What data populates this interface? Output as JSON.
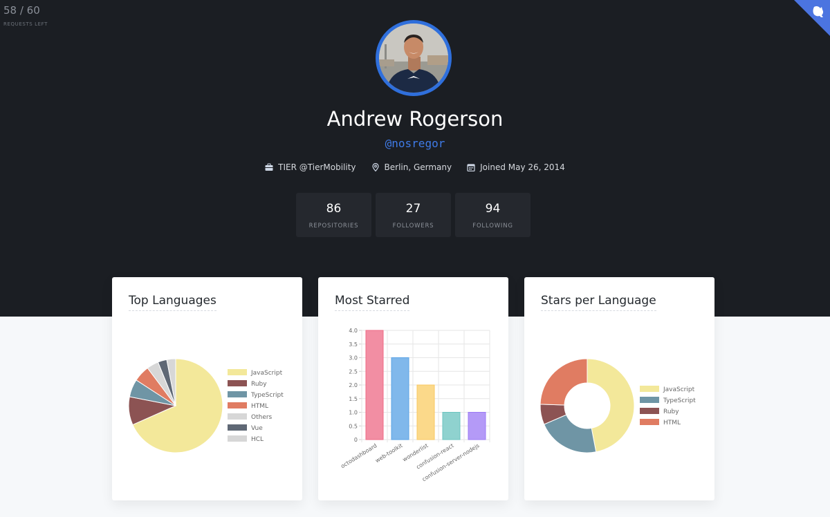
{
  "rate_limit": {
    "value": "58 / 60",
    "label": "REQUESTS LEFT"
  },
  "profile": {
    "name": "Andrew Rogerson",
    "handle": "@nosregor",
    "company": "TIER @TierMobility",
    "location": "Berlin, Germany",
    "joined": "Joined May 26, 2014"
  },
  "stats": [
    {
      "value": "86",
      "label": "REPOSITORIES"
    },
    {
      "value": "27",
      "label": "FOLLOWERS"
    },
    {
      "value": "94",
      "label": "FOLLOWING"
    }
  ],
  "cards": {
    "languages_title": "Top Languages",
    "starred_title": "Most Starred",
    "stars_title": "Stars per Language"
  },
  "chart_data": [
    {
      "type": "pie",
      "title": "Top Languages",
      "legend_placement": "right",
      "categories": [
        "JavaScript",
        "Ruby",
        "TypeScript",
        "HTML",
        "Others",
        "Vue",
        "HCL"
      ],
      "values": [
        67,
        9.5,
        6,
        5.5,
        4,
        3,
        3
      ],
      "colors": [
        "#f3e89a",
        "#8c5353",
        "#6f95a5",
        "#e07c62",
        "#d7d7d7",
        "#5f6875",
        "#d7d7d7"
      ]
    },
    {
      "type": "bar",
      "title": "Most Starred",
      "categories": [
        "octodashboard",
        "web-toolkit",
        "wonderlist",
        "confusion-react",
        "confusion-server-nodejs"
      ],
      "values": [
        4,
        3,
        2,
        1,
        1
      ],
      "ylim": [
        0,
        4
      ],
      "yticks": [
        "0",
        "0.5",
        "1.0",
        "1.5",
        "2.0",
        "2.5",
        "3.0",
        "3.5",
        "4.0"
      ],
      "grid": true,
      "colors": [
        "#f28ea3",
        "#80b8eb",
        "#fbd98a",
        "#8fd2cf",
        "#b49af7"
      ],
      "border_colors": [
        "#ef6b86",
        "#5aa3e6",
        "#f8c862",
        "#6cc4c0",
        "#9b7af5"
      ]
    },
    {
      "type": "pie",
      "title": "Stars per Language",
      "legend_placement": "right",
      "categories": [
        "JavaScript",
        "TypeScript",
        "Ruby",
        "HTML"
      ],
      "values": [
        47,
        21.5,
        7,
        24.5
      ],
      "colors": [
        "#f3e89a",
        "#6f95a5",
        "#8c5353",
        "#e07c62"
      ]
    }
  ]
}
